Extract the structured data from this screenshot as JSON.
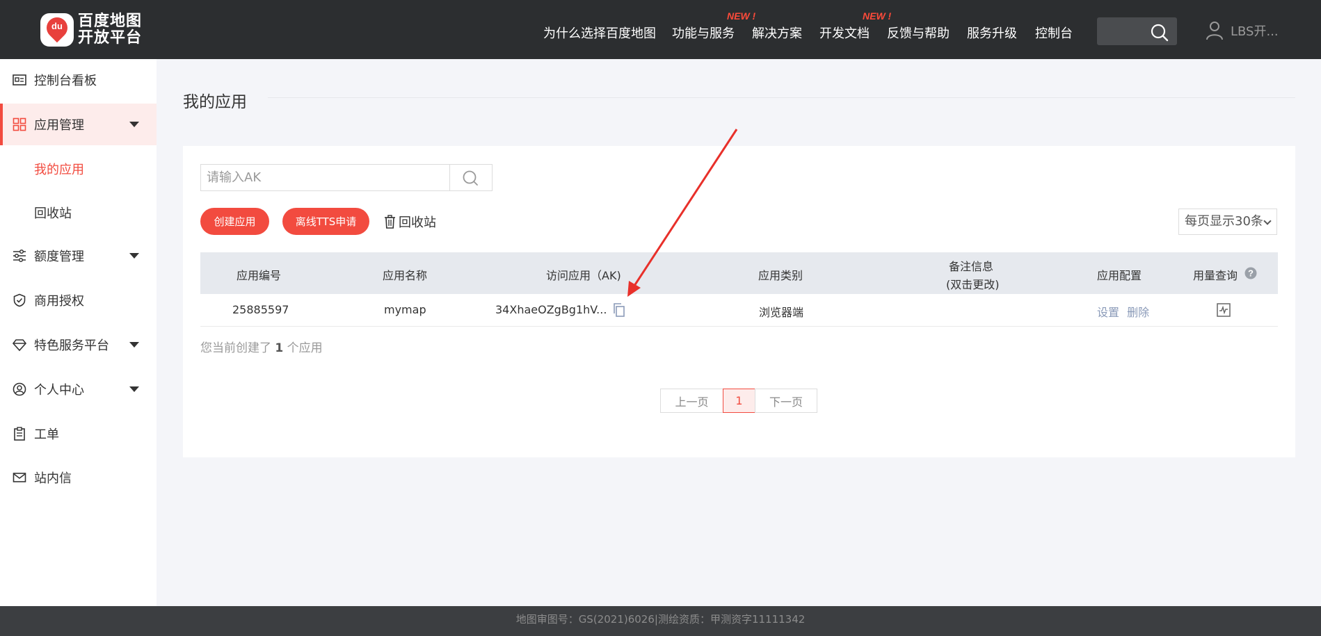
{
  "brand": {
    "logo_mark": "du",
    "logo_line1": "百度地图",
    "logo_line2": "开放平台"
  },
  "topnav": {
    "items": [
      "为什么选择百度地图",
      "功能与服务",
      "解决方案",
      "开发文档",
      "反馈与帮助",
      "服务升级",
      "控制台"
    ],
    "new_tag": "NEW !",
    "user_name": "LBS开..."
  },
  "sidebar": {
    "items": [
      {
        "label": "控制台看板",
        "icon": "id-card-icon"
      },
      {
        "label": "应用管理",
        "icon": "grid-icon"
      },
      {
        "label": "额度管理",
        "icon": "sliders-icon"
      },
      {
        "label": "商用授权",
        "icon": "shield-check-icon"
      },
      {
        "label": "特色服务平台",
        "icon": "diamond-icon"
      },
      {
        "label": "个人中心",
        "icon": "user-circle-icon"
      },
      {
        "label": "工单",
        "icon": "clipboard-icon"
      },
      {
        "label": "站内信",
        "icon": "mail-icon"
      }
    ],
    "sub_items": [
      "我的应用",
      "回收站"
    ]
  },
  "main": {
    "title": "我的应用",
    "search_placeholder": "请输入AK",
    "create_button": "创建应用",
    "tts_button": "离线TTS申请",
    "recycle_link": "回收站",
    "page_size": "每页显示30条"
  },
  "table": {
    "headers": [
      "应用编号",
      "应用名称",
      "访问应用（AK)",
      "应用类别",
      "备注信息",
      "(双击更改)",
      "应用配置",
      "用量查询"
    ],
    "rows": [
      {
        "id": "25885597",
        "name": "mymap",
        "ak": "34XhaeOZgBg1hV...",
        "category": "浏览器端",
        "note": "",
        "config_set": "设置",
        "config_delete": "删除"
      }
    ]
  },
  "summary": {
    "prefix": "您当前创建了",
    "count": "1",
    "suffix": "个应用"
  },
  "pagination": {
    "prev": "上一页",
    "current": "1",
    "next": "下一页"
  },
  "footer": {
    "text": "地图审图号：GS(2021)6026|测绘资质：甲测资字11111342"
  },
  "colors": {
    "accent": "#f24b3f",
    "topbar": "#2c2e30",
    "link": "#8a9ab8",
    "annotation_arrow": "#e8302a"
  }
}
